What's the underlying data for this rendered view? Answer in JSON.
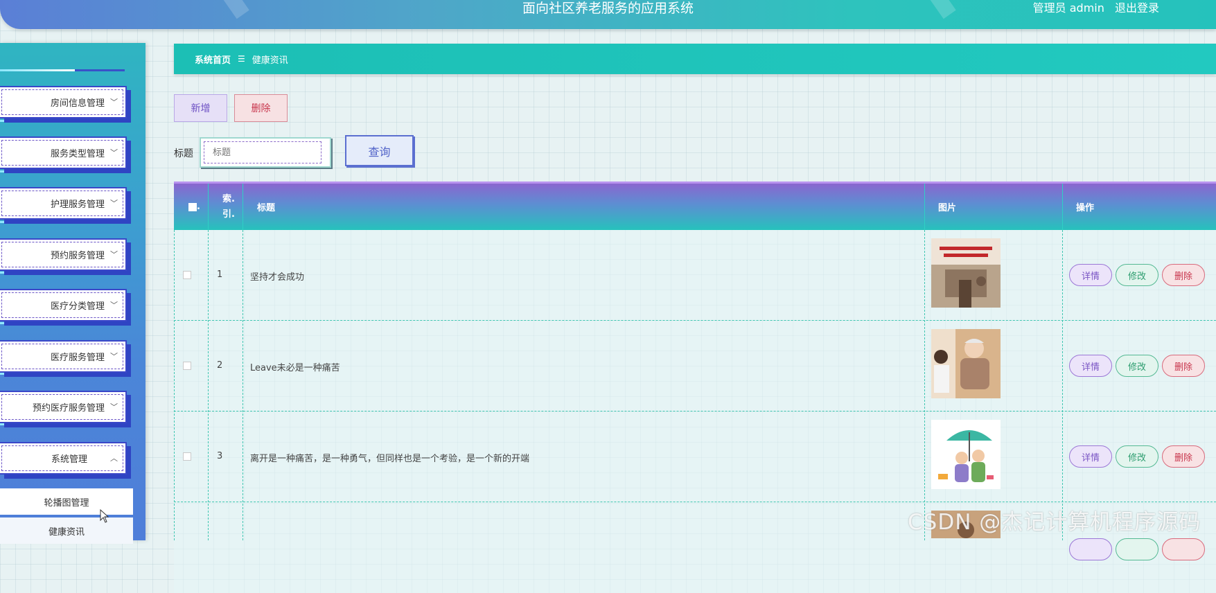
{
  "header": {
    "title": "面向社区养老服务的应用系统",
    "user_role": "管理员 admin",
    "logout": "退出登录"
  },
  "sidebar": {
    "items": [
      {
        "label": "房间信息管理",
        "expanded": false
      },
      {
        "label": "服务类型管理",
        "expanded": false
      },
      {
        "label": "护理服务管理",
        "expanded": false
      },
      {
        "label": "预约服务管理",
        "expanded": false
      },
      {
        "label": "医疗分类管理",
        "expanded": false
      },
      {
        "label": "医疗服务管理",
        "expanded": false
      },
      {
        "label": "预约医疗服务管理",
        "expanded": false
      },
      {
        "label": "系统管理",
        "expanded": true
      }
    ],
    "sub_items": [
      "轮播图管理",
      "健康资讯"
    ]
  },
  "breadcrumb": {
    "home": "系统首页",
    "separator": "☰",
    "current": "健康资讯"
  },
  "toolbar": {
    "add": "新增",
    "delete": "删除",
    "search_label": "标题",
    "search_placeholder": "标题",
    "search_value": "",
    "query": "查询"
  },
  "table": {
    "columns": [
      "索引",
      "标题",
      "图片",
      "操作"
    ],
    "index_header_top": "索.",
    "index_header_bottom": "引.",
    "rows": [
      {
        "index": "1",
        "title": "坚持才会成功"
      },
      {
        "index": "2",
        "title": "Leave未必是一种痛苦"
      },
      {
        "index": "3",
        "title": "离开是一种痛苦，是一种勇气，但同样也是一个考验，是一个新的开端"
      }
    ],
    "actions": {
      "detail": "详情",
      "edit": "修改",
      "delete": "删除"
    }
  },
  "watermark": "CSDN @杰记计算机程序源码",
  "colors": {
    "header_gradient_start": "#5b7fd6",
    "header_gradient_end": "#25c2bc",
    "breadcrumb": "#1cbfb5",
    "table_header_top": "#8a66cf",
    "table_header_bottom": "#26c2bc",
    "delete_red": "#c8364d",
    "add_purple": "#6e51c4"
  }
}
